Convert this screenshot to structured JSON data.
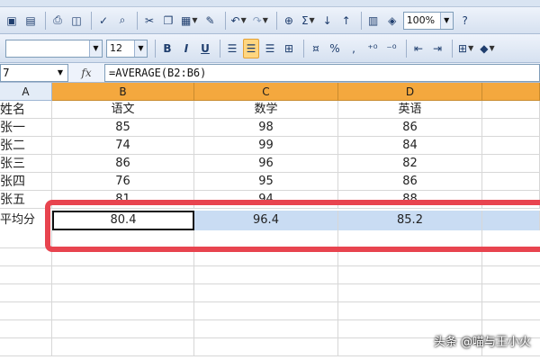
{
  "toolbar1": {
    "zoom": "100%",
    "glyphs": [
      "💾",
      "🖨",
      "🔍",
      "✂",
      "📋",
      "✔",
      "↶",
      "↷",
      "Σ",
      "⇅",
      "📊",
      "?"
    ]
  },
  "toolbar2": {
    "font_size": "12",
    "bold": "B",
    "italic": "I",
    "underline": "U",
    "percent": "%"
  },
  "formula_bar": {
    "name_box": "7",
    "fx_label": "fx",
    "formula": "=AVERAGE(B2:B6)"
  },
  "sheet": {
    "columns": [
      "A",
      "B",
      "C",
      "D"
    ],
    "rows": [
      [
        "姓名",
        "语文",
        "数学",
        "英语"
      ],
      [
        "张一",
        "85",
        "98",
        "86"
      ],
      [
        "张二",
        "74",
        "99",
        "84"
      ],
      [
        "张三",
        "86",
        "96",
        "82"
      ],
      [
        "张四",
        "76",
        "95",
        "86"
      ],
      [
        "张五",
        "81",
        "94",
        "88"
      ],
      [
        "平均分",
        "80.4",
        "96.4",
        "85.2"
      ]
    ]
  },
  "watermark": "头条 @喵与王小火",
  "colors": {
    "selected_header": "#f4a83e",
    "highlight_border": "#e8444f",
    "selection_fill": "#c9dcf3"
  }
}
